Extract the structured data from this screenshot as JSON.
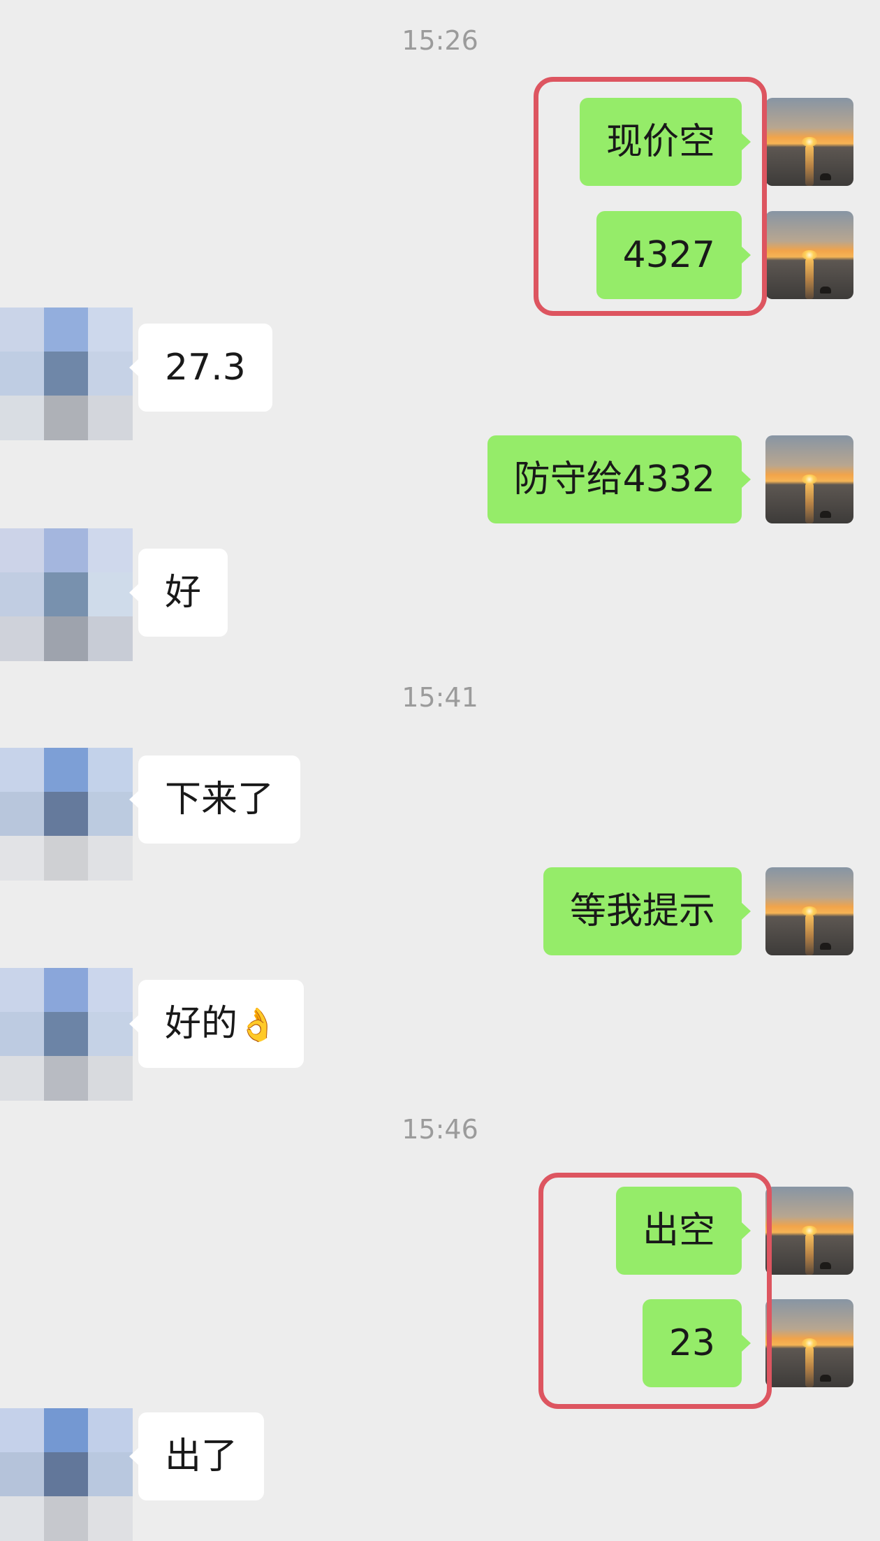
{
  "timestamps": [
    "15:26",
    "15:41",
    "15:46"
  ],
  "messages": {
    "m1": {
      "sender": "me",
      "text": "现价空"
    },
    "m2": {
      "sender": "me",
      "text": "4327"
    },
    "m3": {
      "sender": "friend",
      "text": "27.3"
    },
    "m4": {
      "sender": "me",
      "text": "防守给4332"
    },
    "m5": {
      "sender": "friend",
      "text": "好"
    },
    "m6": {
      "sender": "friend",
      "text": "下来了"
    },
    "m7": {
      "sender": "me",
      "text": "等我提示"
    },
    "m8": {
      "sender": "friend",
      "text": "好的",
      "emoji": "👌"
    },
    "m9": {
      "sender": "me",
      "text": "出空"
    },
    "m10": {
      "sender": "me",
      "text": "23"
    },
    "m11": {
      "sender": "friend",
      "text": "出了"
    }
  },
  "avatars": {
    "me": {
      "icon": "sunset-avatar-icon"
    },
    "friend": {
      "icon": "pixelated-avatar-icon"
    }
  },
  "colors": {
    "background": "#ededed",
    "my_bubble": "#95ec69",
    "friend_bubble": "#ffffff",
    "timestamp_text": "#9b9b9b",
    "highlight_border": "#dd5560"
  }
}
